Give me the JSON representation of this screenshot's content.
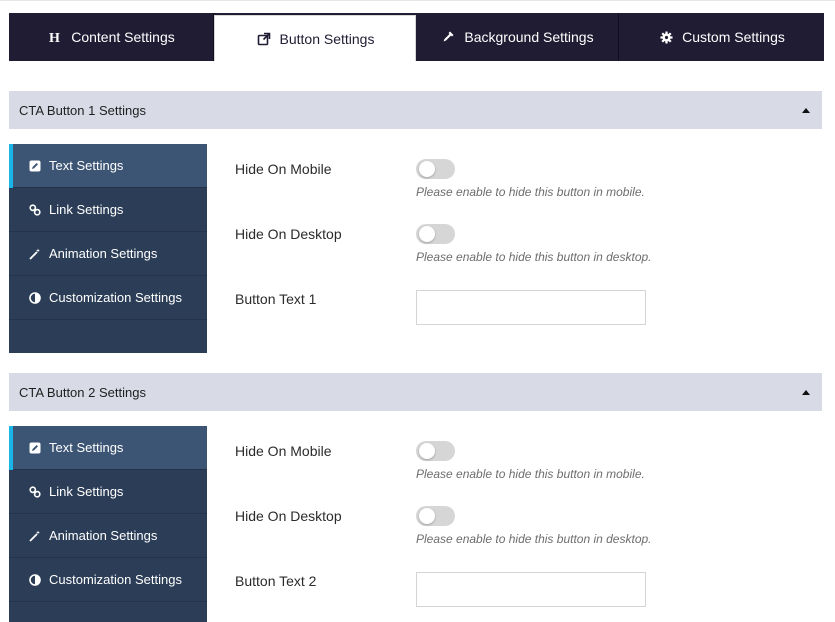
{
  "tabs": [
    {
      "label": "Content Settings",
      "icon": "heading-icon"
    },
    {
      "label": "Button Settings",
      "icon": "external-link-icon",
      "active": true
    },
    {
      "label": "Background Settings",
      "icon": "eyedropper-icon"
    },
    {
      "label": "Custom Settings",
      "icon": "gear-icon"
    }
  ],
  "sections": [
    {
      "title": "CTA Button 1 Settings",
      "nav": [
        {
          "label": "Text Settings",
          "icon": "edit-icon",
          "active": true
        },
        {
          "label": "Link Settings",
          "icon": "link-icon"
        },
        {
          "label": "Animation Settings",
          "icon": "magic-wand-icon"
        },
        {
          "label": "Customization Settings",
          "icon": "contrast-icon"
        }
      ],
      "fields": {
        "hide_mobile_label": "Hide On Mobile",
        "hide_mobile_hint": "Please enable to hide this button in mobile.",
        "hide_mobile_enabled": false,
        "hide_desktop_label": "Hide On Desktop",
        "hide_desktop_hint": "Please enable to hide this button in desktop.",
        "hide_desktop_enabled": false,
        "button_text_label": "Button Text 1",
        "button_text_value": ""
      }
    },
    {
      "title": "CTA Button 2 Settings",
      "nav": [
        {
          "label": "Text Settings",
          "icon": "edit-icon",
          "active": true
        },
        {
          "label": "Link Settings",
          "icon": "link-icon"
        },
        {
          "label": "Animation Settings",
          "icon": "magic-wand-icon"
        },
        {
          "label": "Customization Settings",
          "icon": "contrast-icon"
        }
      ],
      "fields": {
        "hide_mobile_label": "Hide On Mobile",
        "hide_mobile_hint": "Please enable to hide this button in mobile.",
        "hide_mobile_enabled": false,
        "hide_desktop_label": "Hide On Desktop",
        "hide_desktop_hint": "Please enable to hide this button in desktop.",
        "hide_desktop_enabled": false,
        "button_text_label": "Button Text 2",
        "button_text_value": ""
      }
    }
  ],
  "colors": {
    "tab_bar": "#1f1c33",
    "section_header": "#d8dbe6",
    "sidenav": "#2c3e57",
    "sidenav_active": "#3d5575",
    "active_indicator": "#19b5e8",
    "toggle_off": "#d6d6d6"
  }
}
